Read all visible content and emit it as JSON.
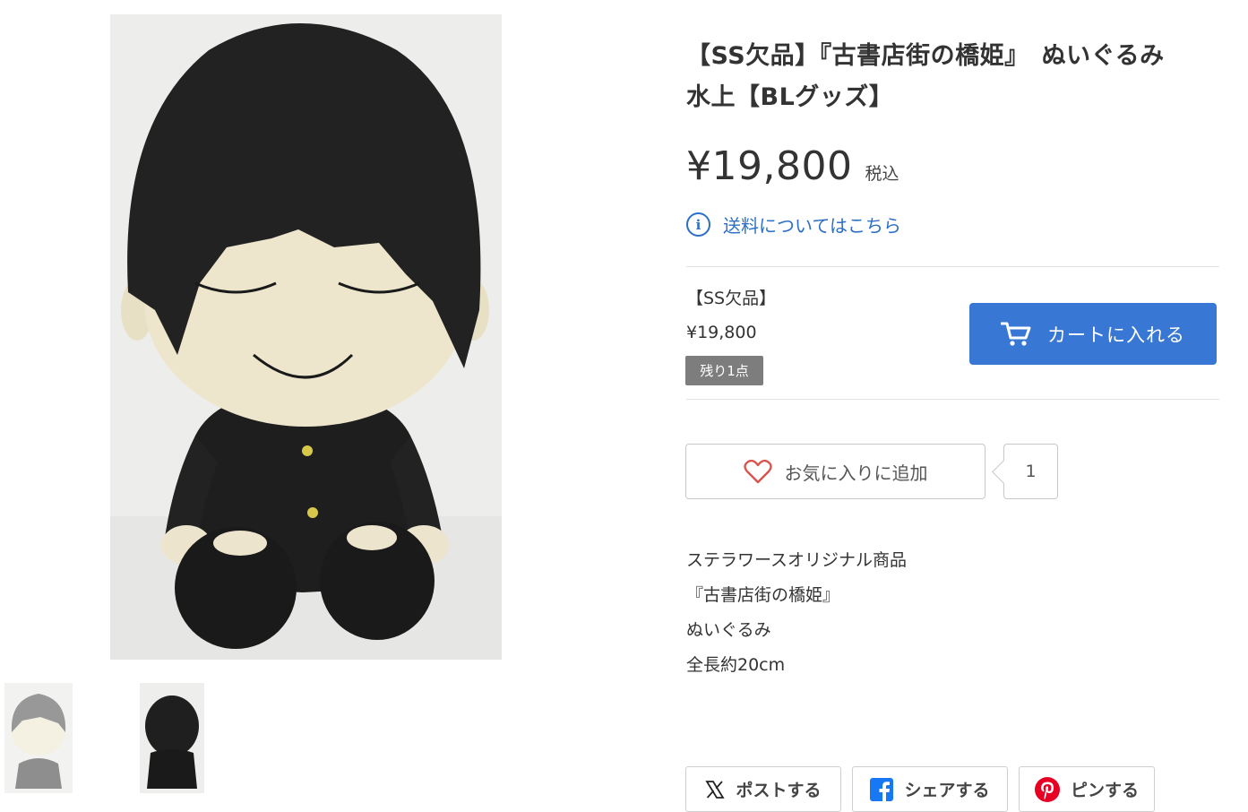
{
  "product": {
    "title": "【SS欠品】『古書店街の橋姫』　ぬいぐるみ　水上【BLグッズ】",
    "price": "¥19,800",
    "tax_label": "税込",
    "shipping_link": "送料についてはこちら"
  },
  "variant": {
    "name": "【SS欠品】",
    "price": "¥19,800",
    "stock": "残り1点"
  },
  "cart": {
    "label": "カートに入れる"
  },
  "favorite": {
    "label": "お気に入りに追加",
    "count": "1"
  },
  "description": {
    "lines": [
      "ステラワースオリジナル商品",
      "『古書店街の橋姫』",
      "ぬいぐるみ",
      "全長約20cm"
    ]
  },
  "share": {
    "x_label": "ポストする",
    "facebook_label": "シェアする",
    "pinterest_label": "ピンする"
  },
  "icons": {
    "cart": "cart-icon",
    "info": "info-icon",
    "heart": "heart-icon",
    "x": "x-logo-icon",
    "facebook": "facebook-icon",
    "pinterest": "pinterest-icon"
  },
  "colors": {
    "accent": "#3878d4",
    "link": "#2d6fc4",
    "badge": "#7d7d7d",
    "heart": "#d9534f",
    "facebook": "#1877f2",
    "pinterest": "#e60023"
  }
}
